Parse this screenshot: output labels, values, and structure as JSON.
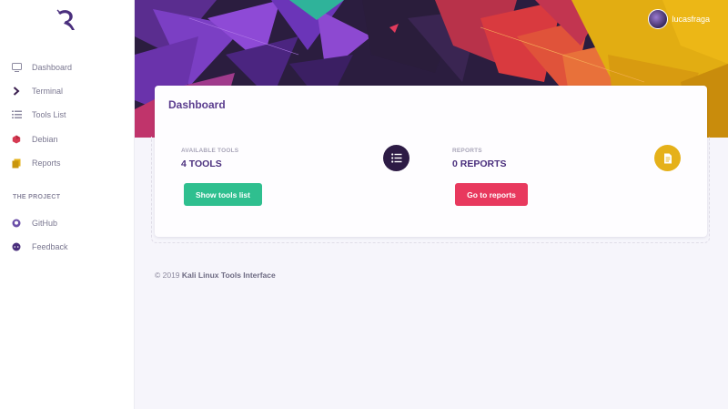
{
  "sidebar": {
    "nav_items": [
      {
        "label": "Dashboard",
        "icon": "monitor-icon"
      },
      {
        "label": "Terminal",
        "icon": "chevron-right-icon"
      },
      {
        "label": "Tools List",
        "icon": "list-icon"
      },
      {
        "label": "Debian",
        "icon": "debian-icon"
      },
      {
        "label": "Reports",
        "icon": "copy-icon"
      }
    ],
    "section_title": "THE PROJECT",
    "project_items": [
      {
        "label": "GitHub",
        "icon": "github-icon"
      },
      {
        "label": "Feedback",
        "icon": "chat-icon"
      }
    ]
  },
  "header": {
    "username": "lucasfraga"
  },
  "dashboard": {
    "title": "Dashboard",
    "tools": {
      "label": "AVAILABLE TOOLS",
      "value": "4 TOOLS",
      "button": "Show tools list",
      "icon": "list-icon"
    },
    "reports": {
      "label": "REPORTS",
      "value": "0 REPORTS",
      "button": "Go to reports",
      "icon": "document-icon"
    }
  },
  "footer": {
    "copyright": "© 2019",
    "product": "Kali Linux Tools Interface"
  },
  "colors": {
    "accent_purple": "#4a2f7d",
    "green_button": "#2fbf8f",
    "red_button": "#e8395e",
    "tools_icon_bg": "#2d1b45",
    "reports_icon_bg": "#e5b11a"
  }
}
